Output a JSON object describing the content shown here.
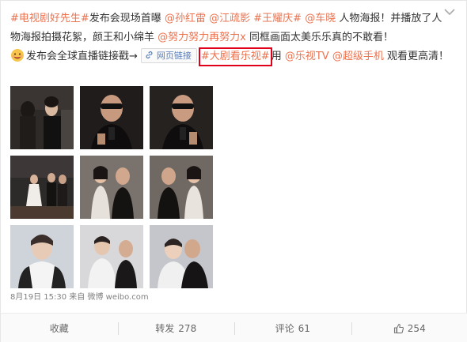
{
  "post": {
    "text": [
      {
        "t": "#电视剧好先生#",
        "link": true
      },
      {
        "t": "发布会现场首曝 ",
        "link": false
      },
      {
        "t": "@孙红雷",
        "link": true
      },
      {
        "t": " ",
        "link": false
      },
      {
        "t": "@江疏影",
        "link": true
      },
      {
        "t": " ",
        "link": false
      },
      {
        "t": "#王耀庆#",
        "link": true
      },
      {
        "t": " ",
        "link": false
      },
      {
        "t": "@车晓",
        "link": true
      },
      {
        "t": " 人物海报！并播放了人物海报拍摄花絮，颜王和小绵羊 ",
        "link": false
      },
      {
        "t": "@努力努力再努力x",
        "link": true
      },
      {
        "t": " 同框画面太美乐乐真的不敢看！",
        "link": false
      }
    ],
    "text_line3_before": "发布会全球直播链接戳→",
    "web_link_label": "网页链接",
    "highlight_tag": "#大剧看乐视#",
    "text_after_tag": "用 ",
    "mention_letv": "@乐视TV",
    "mention_phone": "@超级手机",
    "text_tail": " 观看更高清！",
    "emoji_name": "face-emoji-icon",
    "link_icon_name": "link-icon"
  },
  "images": [
    {
      "name": "photo-press-conference-1"
    },
    {
      "name": "photo-sun-honglei-1"
    },
    {
      "name": "photo-sun-honglei-2"
    },
    {
      "name": "photo-stage-group-1"
    },
    {
      "name": "photo-cast-portrait-1"
    },
    {
      "name": "photo-cast-portrait-2"
    },
    {
      "name": "photo-actor-white-shirt"
    },
    {
      "name": "photo-actors-backstage"
    },
    {
      "name": "photo-actors-kiss"
    }
  ],
  "meta": {
    "time": "8月19日 15:30",
    "from_label": "来自",
    "source": "微博 weibo.com"
  },
  "actions": {
    "favorite_label": "收藏",
    "repost_label": "转发",
    "repost_count": "278",
    "comment_label": "评论",
    "comment_count": "61",
    "like_count": "254"
  },
  "colors": {
    "link": "#eb7350",
    "highlight_border": "#e0001b",
    "meta_text": "#808080",
    "weblink_text": "#5a7fb8"
  }
}
